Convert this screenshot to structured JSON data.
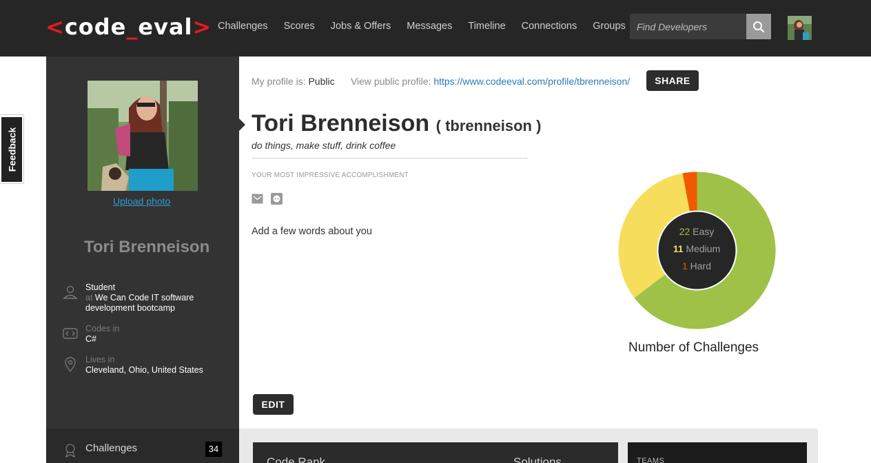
{
  "header": {
    "logo": {
      "open": "<",
      "text_a": "code",
      "text_b": "_",
      "text_c": "eval",
      "close": ">"
    },
    "nav": [
      "Challenges",
      "Scores",
      "Jobs & Offers",
      "Messages",
      "Timeline",
      "Connections",
      "Groups"
    ],
    "search_placeholder": "Find Developers",
    "search_icon": "search-icon",
    "avatar": "user-avatar"
  },
  "feedback": {
    "label": "Feedback"
  },
  "sidebar": {
    "upload_label": "Upload photo",
    "name": "Tori Brenneison",
    "role": "Student",
    "at_label": "at",
    "company": "We Can Code IT software development bootcamp",
    "codes_in_label": "Codes in",
    "language": "C#",
    "lives_in_label": "Lives in",
    "location": "Cleveland, Ohio, United States",
    "bottom_item": {
      "label": "Challenges",
      "count": "34"
    }
  },
  "profile": {
    "status_label": "My profile is:",
    "status_value": "Public",
    "public_profile_label": "View public profile:",
    "public_profile_url": "https://www.codeeval.com/profile/tbrenneison/",
    "share_label": "SHARE",
    "full_name": "Tori Brenneison",
    "username": "( tbrenneison )",
    "tagline": "do things, make stuff, drink coffee",
    "accomplishment_label": "YOUR MOST IMPRESSIVE ACCOMPLISHMENT",
    "about_text": "Add a few words about you",
    "edit_label": "EDIT"
  },
  "chart_data": {
    "type": "pie",
    "title": "Number of Challenges",
    "categories": [
      "Easy",
      "Medium",
      "Hard"
    ],
    "values": [
      22,
      11,
      1
    ],
    "colors": [
      "#9fc147",
      "#f6dd5c",
      "#ef5a00"
    ],
    "label_colors": [
      "#9fc147",
      "#f6dd5c",
      "#ef5a00"
    ]
  },
  "bottom_panels": {
    "rank_label": "Code Rank",
    "solutions_label": "Solutions",
    "teams_label": "TEAMS"
  },
  "colors": {
    "accent_red": "#e8181e",
    "link_blue": "#2a7ab8",
    "dark_bg": "#262626",
    "sidebar_bg": "#333333"
  }
}
